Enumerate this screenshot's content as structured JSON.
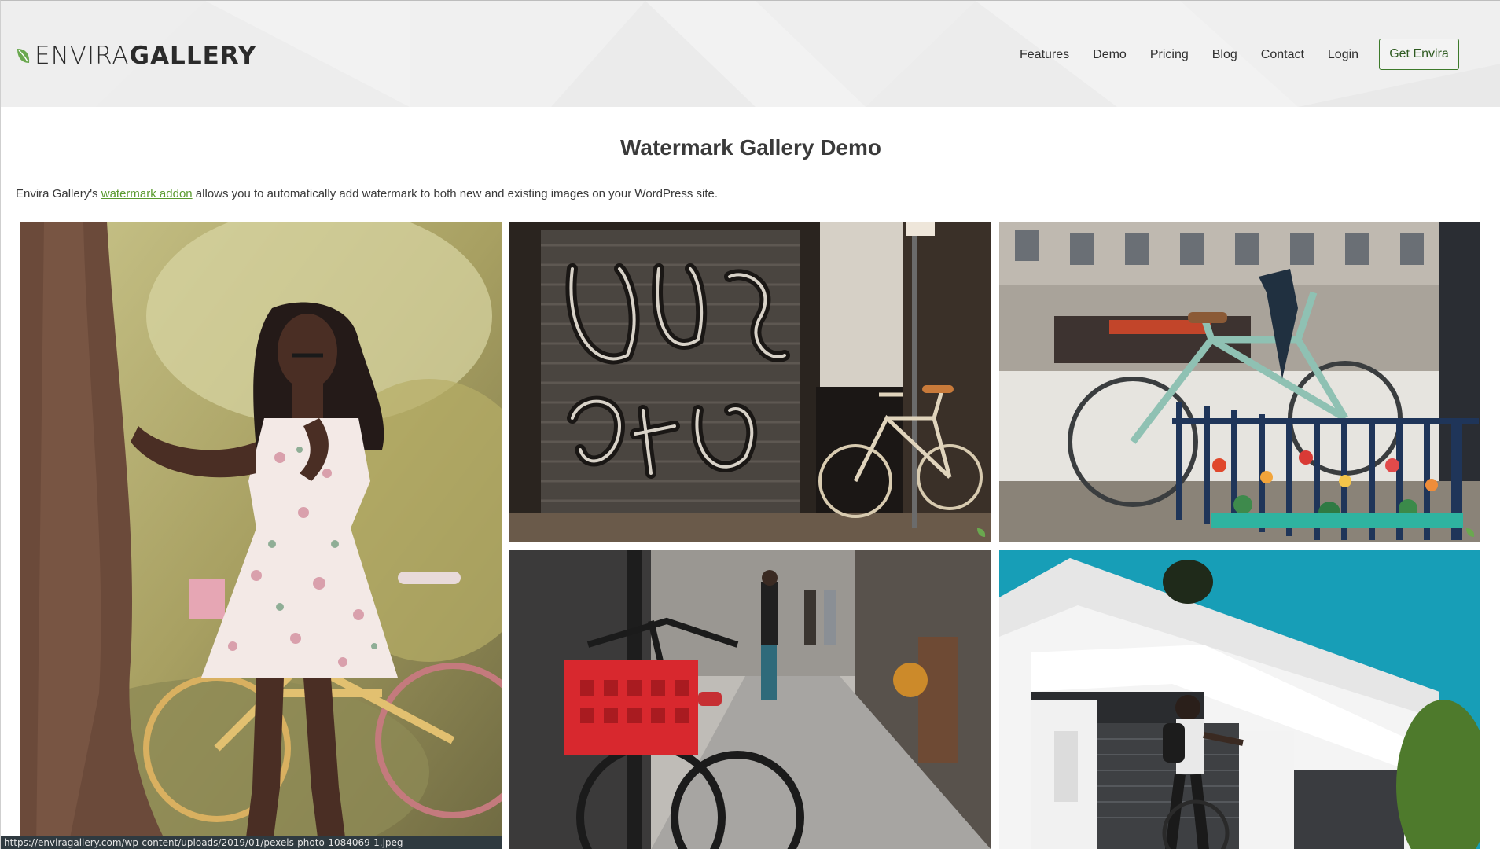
{
  "brand": {
    "logo_light": "ENVIRA",
    "logo_bold": "GALLERY",
    "accent_color": "#6aa84f"
  },
  "nav": {
    "items": [
      {
        "label": "Features"
      },
      {
        "label": "Demo"
      },
      {
        "label": "Pricing"
      },
      {
        "label": "Blog"
      },
      {
        "label": "Contact"
      },
      {
        "label": "Login"
      }
    ],
    "cta_label": "Get Envira"
  },
  "main": {
    "title": "Watermark Gallery Demo",
    "intro_before": "Envira Gallery's ",
    "intro_link": "watermark addon",
    "intro_after": " allows you to automatically add watermark to both new and existing images on your WordPress site."
  },
  "gallery": {
    "images": [
      {
        "subject": "woman in floral dress beside tree and bicycle"
      },
      {
        "subject": "graffiti shutter with bicycle"
      },
      {
        "subject": "parked bicycles by flower fence"
      },
      {
        "subject": "bicycle with red crate on street"
      },
      {
        "subject": "cyclist by white modern building"
      }
    ],
    "watermark_icon": "leaf-icon"
  },
  "statusbar": {
    "url": "https://enviragallery.com/wp-content/uploads/2019/01/pexels-photo-1084069-1.jpeg"
  }
}
